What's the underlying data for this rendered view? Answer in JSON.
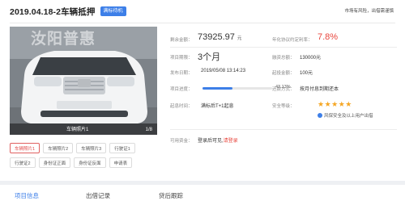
{
  "header": {
    "title": "2019.04.18-2车辆抵押",
    "tag": "满标待机",
    "risk_note": "市场有风险，出借需谨慎"
  },
  "photo": {
    "watermark": "汝阳普惠",
    "caption": "车辆照片1",
    "counter": "1/8"
  },
  "thumbs": [
    "车辆照片1",
    "车辆照片2",
    "车辆照片3",
    "行驶证1",
    "行驶证2",
    "身份证正面",
    "身份证反面",
    "申请表"
  ],
  "info": {
    "remaining_label": "剩余金额：",
    "remaining_value": "73925.97",
    "remaining_unit": "元",
    "rate_label": "年化协议约定利率：",
    "rate_value": "7.8%",
    "term_label": "项目期限：",
    "term_value": "3个月",
    "total_label": "融资总额：",
    "total_value": "130000元",
    "release_label": "发布日期：",
    "release_value": "2019/05/08 13:14:23",
    "min_label": "起投金额：",
    "min_value": "100元",
    "progress_label": "项目进度：",
    "progress_pct_text": "43.13%",
    "progress_value": 0.4313,
    "repay_label": "还款方式：",
    "repay_value": "按月付息到期还本",
    "interest_label": "起息时间：",
    "interest_value": "满标后T+1起息",
    "safety_label": "安全等级：",
    "stars": "★★★★★",
    "guarantee": "风保安全及以上用户出借",
    "available_label": "可用资金：",
    "available_text": "登录后可见,",
    "login_link": "请登录"
  },
  "tabs": [
    "项目信息",
    "出借记录",
    "贷后跟踪"
  ],
  "colors": {
    "accent": "#3d7fe8",
    "danger": "#e8453c",
    "star": "#f5a623"
  }
}
